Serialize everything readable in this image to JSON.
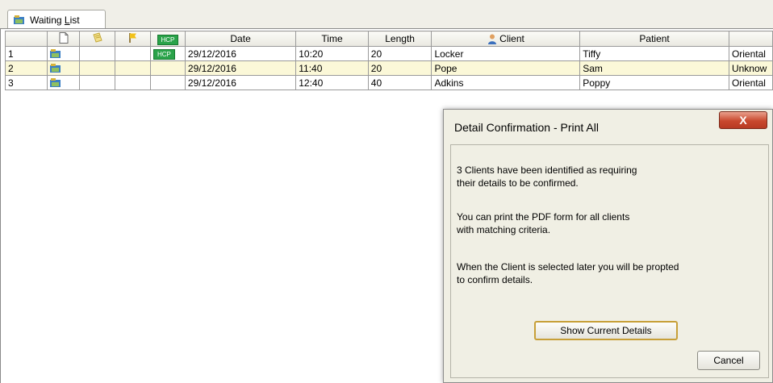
{
  "tab": {
    "label_prefix": "Waiting ",
    "label_u": "L",
    "label_rest": "ist"
  },
  "grid": {
    "headers": {
      "hcp": "HCP",
      "date": "Date",
      "time": "Time",
      "length": "Length",
      "client": "Client",
      "patient": "Patient"
    },
    "rows": [
      {
        "num": "1",
        "hcp": "HCP",
        "date": "29/12/2016",
        "time": "10:20",
        "length": "20",
        "client": "Locker",
        "patient": "Tiffy",
        "breed": "Oriental"
      },
      {
        "num": "2",
        "hcp": "",
        "date": "29/12/2016",
        "time": "11:40",
        "length": "20",
        "client": "Pope",
        "patient": "Sam",
        "breed": "Unknow"
      },
      {
        "num": "3",
        "hcp": "",
        "date": "29/12/2016",
        "time": "12:40",
        "length": "40",
        "client": "Adkins",
        "patient": "Poppy",
        "breed": "Oriental"
      }
    ]
  },
  "dialog": {
    "title": "Detail Confirmation - Print All",
    "close": "X",
    "msg1_line1": "3 Clients have been identified as requiring",
    "msg1_line2": "their details to be confirmed.",
    "msg2_line1": "You can print the PDF form for all clients",
    "msg2_line2": "with matching criteria.",
    "msg3_line1": "When the Client is selected later you will be propted",
    "msg3_line2": "to confirm details.",
    "show_button": "Show Current Details",
    "cancel_button": "Cancel"
  },
  "colors": {
    "selected_row": "#fbf8d8",
    "hcp_badge": "#2aa34a",
    "close_button": "#c8482e"
  }
}
